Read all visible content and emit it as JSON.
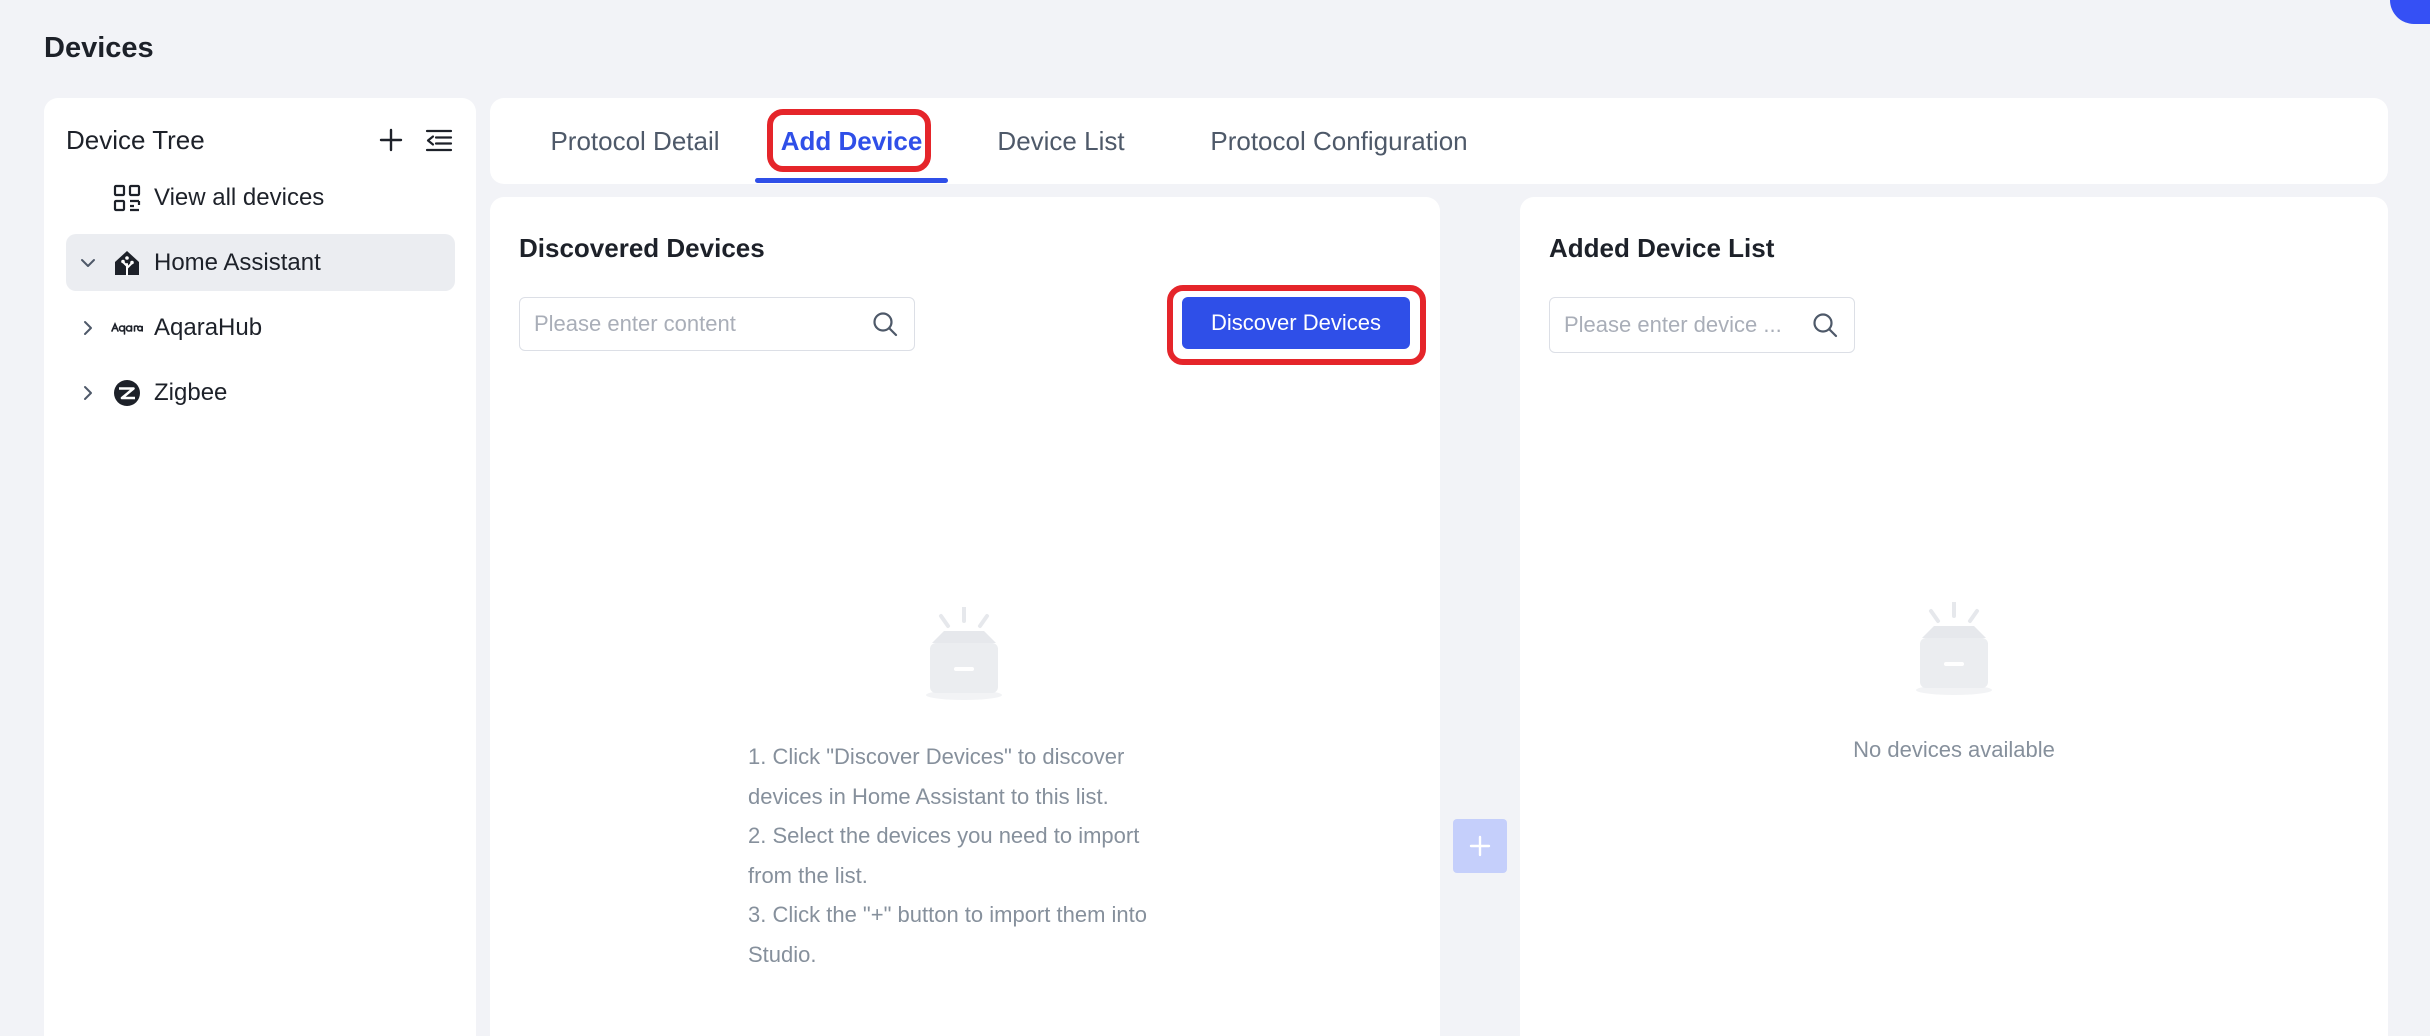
{
  "page": {
    "title": "Devices"
  },
  "sidebar": {
    "title": "Device Tree",
    "add_icon": "plus-icon",
    "collapse_icon": "indent-list-icon",
    "items": [
      {
        "label": "View all devices",
        "icon": "grid-icon",
        "expandable": false,
        "active": false
      },
      {
        "label": "Home Assistant",
        "icon": "home-assistant-icon",
        "expandable": true,
        "expanded": true,
        "active": true
      },
      {
        "label": "AqaraHub",
        "icon": "aqara-logo-icon",
        "expandable": true,
        "expanded": false,
        "active": false
      },
      {
        "label": "Zigbee",
        "icon": "zigbee-icon",
        "expandable": true,
        "expanded": false,
        "active": false
      }
    ]
  },
  "tabs": [
    {
      "label": "Protocol Detail",
      "active": false
    },
    {
      "label": "Add Device",
      "active": true
    },
    {
      "label": "Device List",
      "active": false
    },
    {
      "label": "Protocol Configuration",
      "active": false
    }
  ],
  "discovered": {
    "title": "Discovered Devices",
    "search_placeholder": "Please enter content",
    "search_value": "",
    "discover_button": "Discover Devices",
    "instructions": [
      "1. Click \"Discover Devices\" to discover devices in Home Assistant to this list.",
      "2. Select the devices you need to import from the list.",
      "3. Click the \"+\" button to import them into Studio."
    ]
  },
  "added": {
    "title": "Added Device List",
    "search_placeholder": "Please enter device ...",
    "search_value": "",
    "empty_text": "No devices available"
  },
  "import_button": {
    "icon": "plus-icon",
    "enabled": false
  },
  "colors": {
    "accent": "#2f4fe8",
    "highlight": "#e5252a",
    "background": "#f2f3f7",
    "muted_text": "#86909c",
    "disabled_button": "#c5cffb"
  }
}
